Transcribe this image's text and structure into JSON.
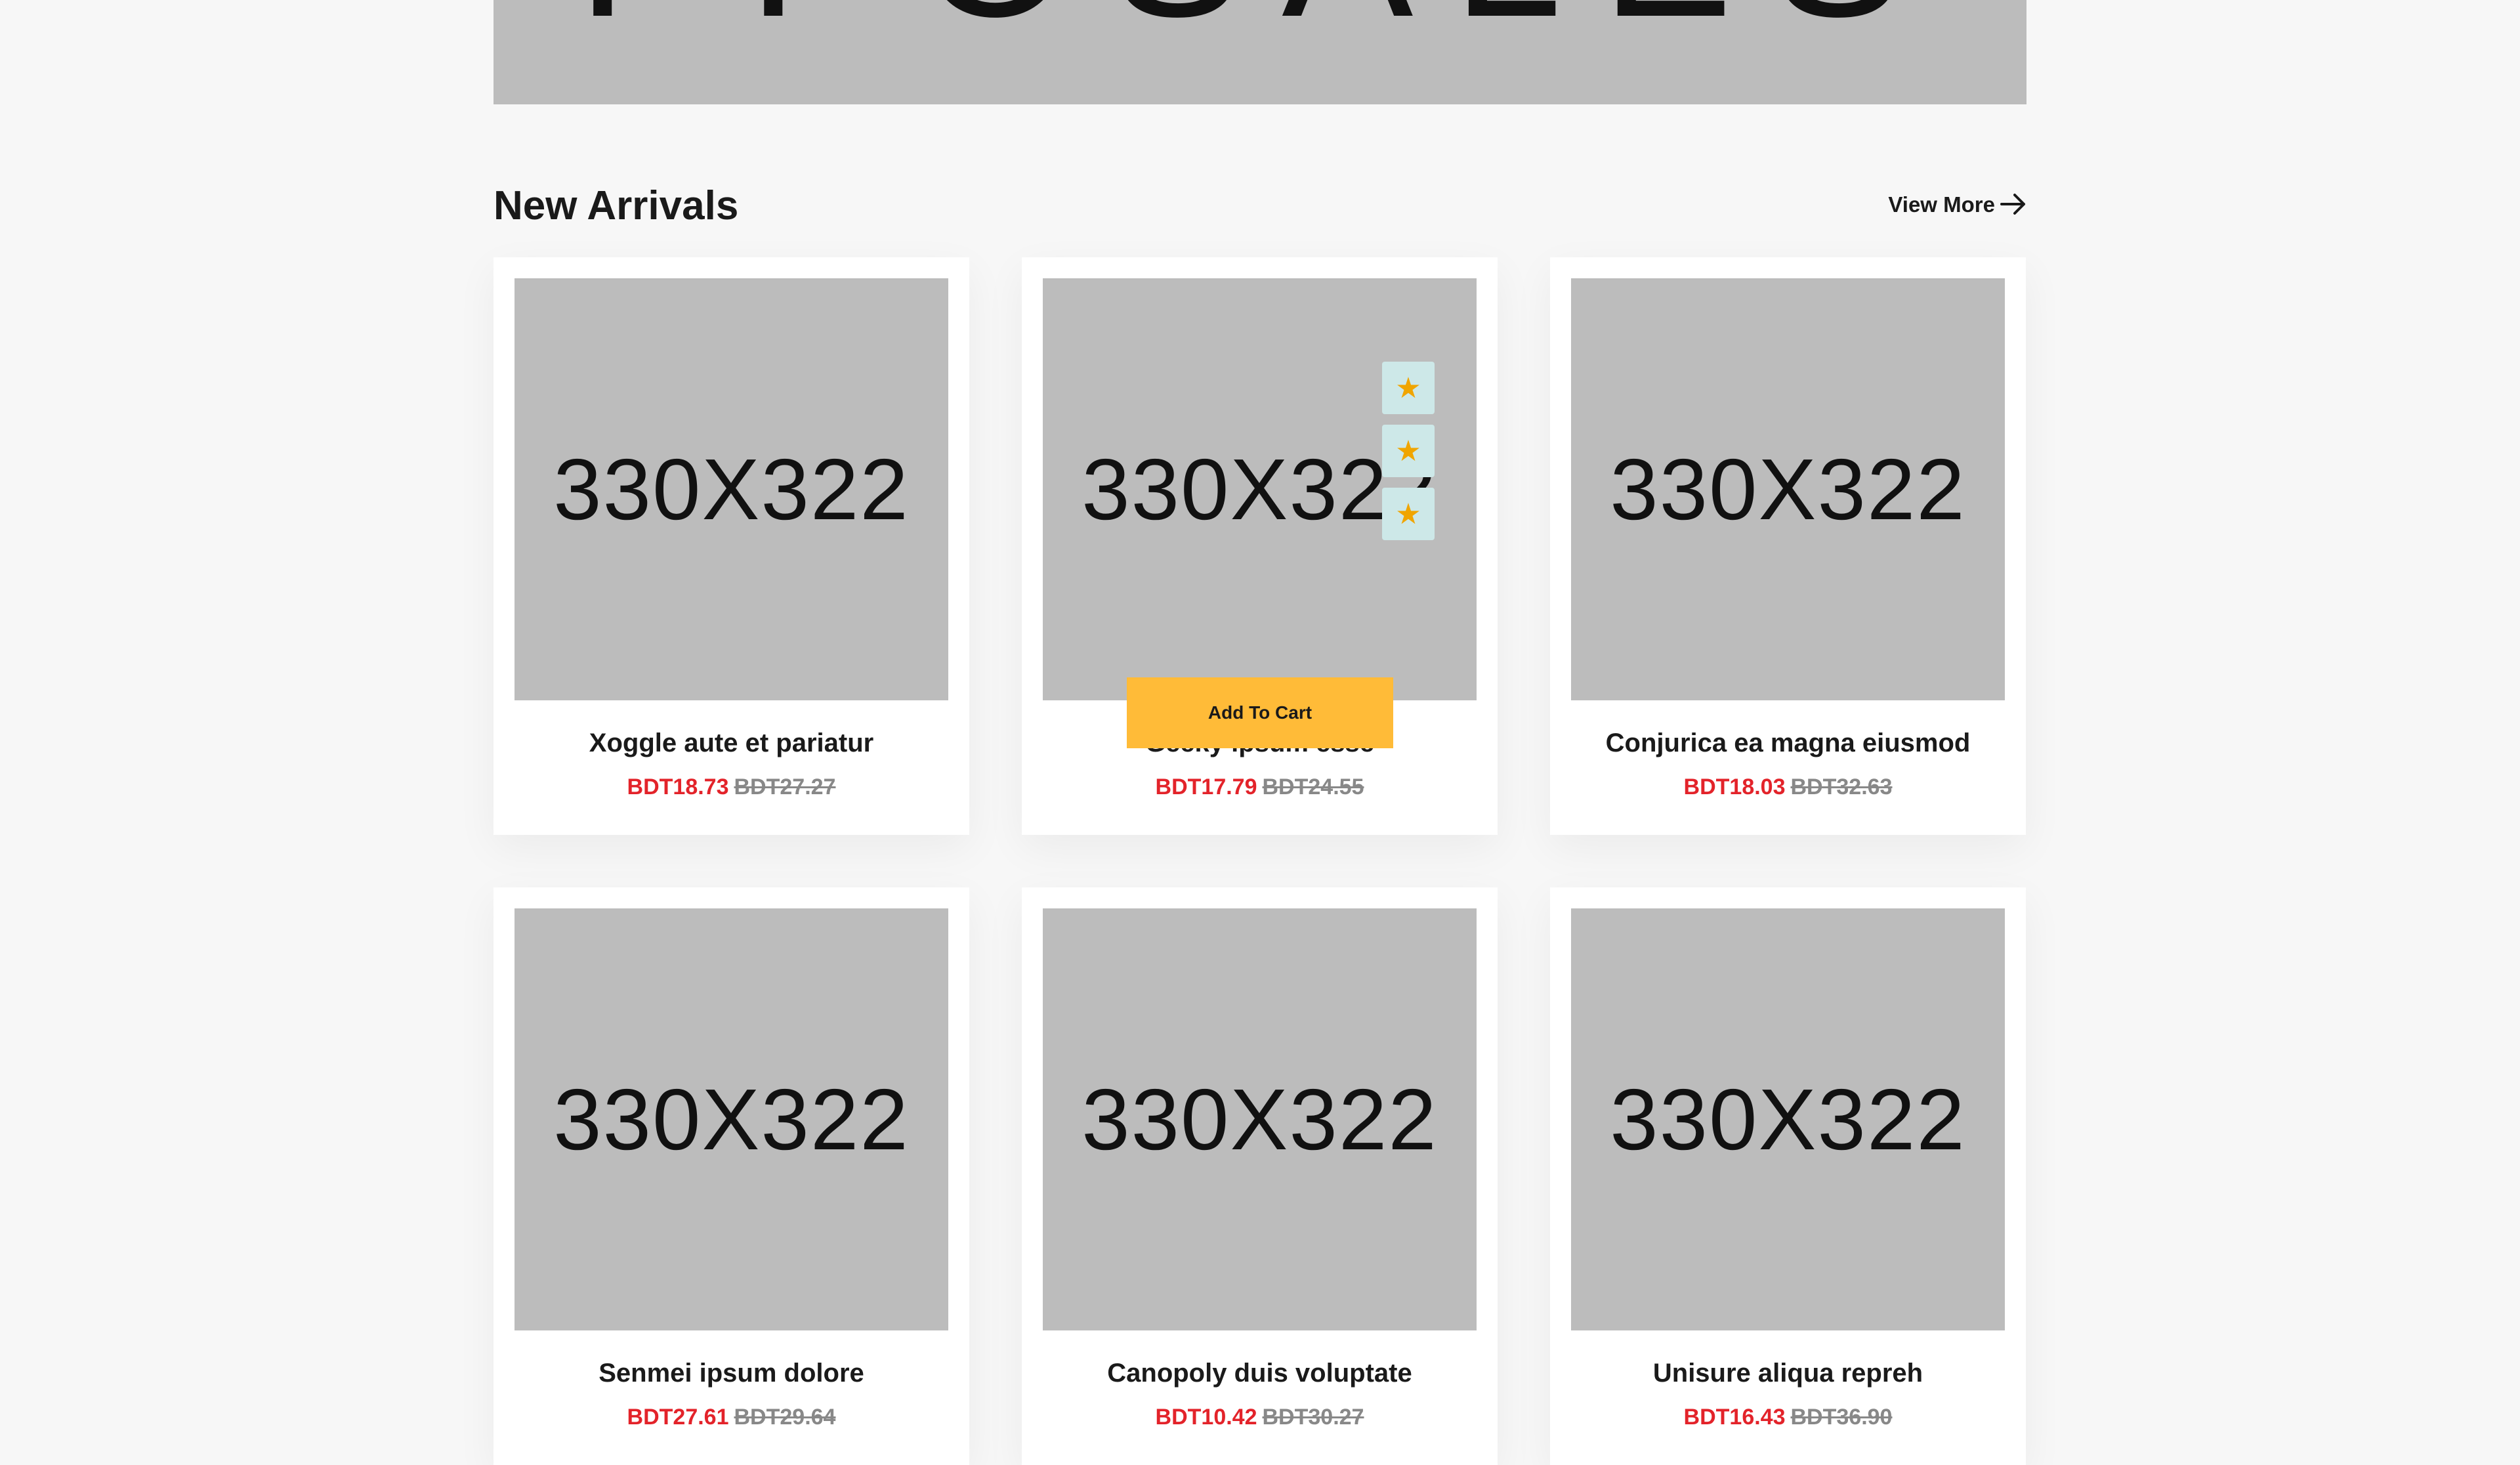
{
  "hero": {
    "text": "PPOSALES"
  },
  "section": {
    "title": "New Arrivals",
    "view_more_label": "View More",
    "arrow_icon": "arrow-right-icon"
  },
  "cards": [
    {
      "image_text": "330X322",
      "name": "Xoggle aute et pariatur",
      "price": "BDT18.73",
      "old_price": "BDT27.27"
    },
    {
      "image_text": "330X322",
      "name": "Geeky ipsum esse",
      "price": "BDT17.79",
      "old_price": "BDT24.55",
      "hover": {
        "add_to_cart_label": "Add To Cart",
        "action_icons": [
          "star-icon",
          "star-icon",
          "star-icon"
        ],
        "action_glyph": "★"
      }
    },
    {
      "image_text": "330X322",
      "name": "Conjurica ea magna eiusmod",
      "price": "BDT18.03",
      "old_price": "BDT32.63"
    },
    {
      "image_text": "330X322",
      "name": "Senmei ipsum dolore",
      "price": "BDT27.61",
      "old_price": "BDT29.64"
    },
    {
      "image_text": "330X322",
      "name": "Canopoly duis voluptate",
      "price": "BDT10.42",
      "old_price": "BDT30.27"
    },
    {
      "image_text": "330X322",
      "name": "Unisure aliqua repreh",
      "price": "BDT16.43",
      "old_price": "BDT36.90"
    }
  ],
  "colors": {
    "sale_price": "#e3232a",
    "old_price": "#888888",
    "add_to_cart_bg": "#ffbb38",
    "action_btn_bg": "#cde8e8",
    "star": "#f0a500",
    "placeholder_bg": "#bcbcbc",
    "page_bg": "#f7f7f7"
  }
}
